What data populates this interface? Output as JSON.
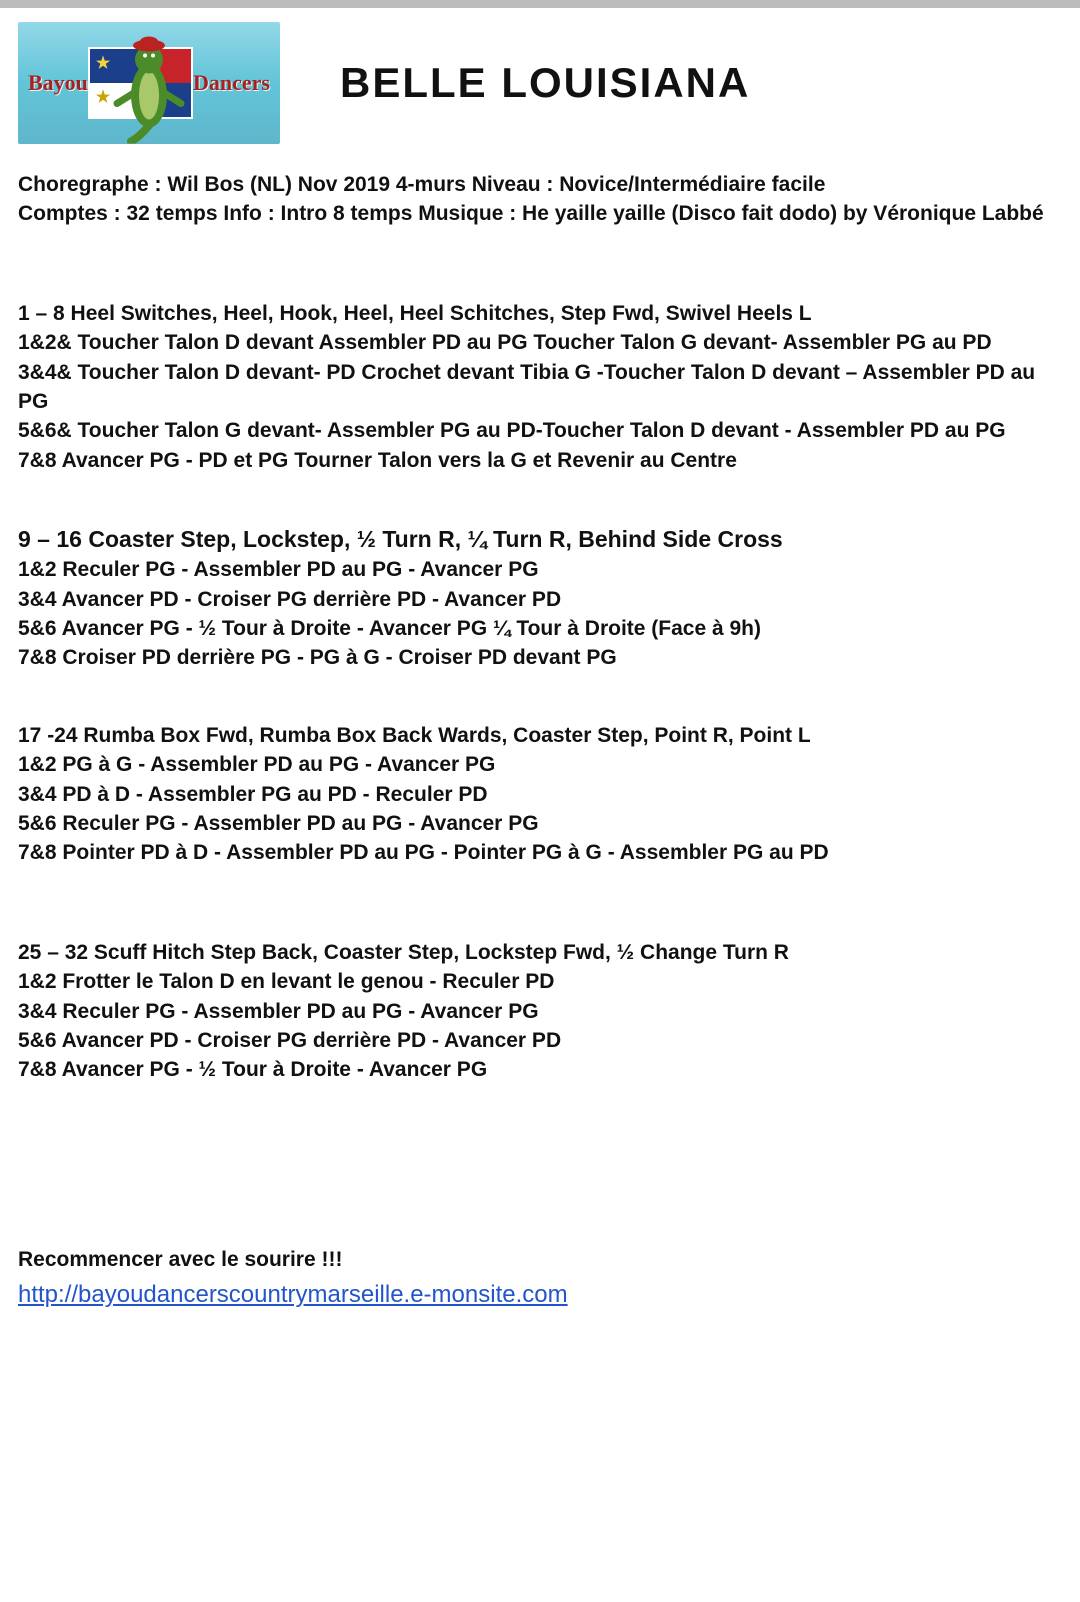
{
  "logo": {
    "left_text": "Bayou",
    "right_text": "Dancers"
  },
  "title": "BELLE LOUISIANA",
  "meta_lines": [
    "Choregraphe : Wil Bos (NL) Nov 2019 4-murs Niveau : Novice/Intermédiaire facile",
    "Comptes : 32 temps Info : Intro 8 temps Musique : He yaille yaille (Disco fait dodo) by Véronique Labbé"
  ],
  "sections": [
    {
      "head": "1 – 8 Heel Switches, Heel, Hook, Heel, Heel Schitches, Step Fwd, Swivel Heels L",
      "steps": [
        "1&2& Toucher Talon D devant Assembler PD au PG Toucher Talon G devant- Assembler PG au PD",
        "3&4& Toucher Talon D devant- PD Crochet devant Tibia G -Toucher Talon D devant – Assembler PD au PG",
        "5&6& Toucher Talon G devant- Assembler PG au PD-Toucher Talon D devant - Assembler PD au PG",
        "7&8 Avancer PG - PD et PG Tourner Talon vers la G et Revenir au Centre"
      ]
    },
    {
      "head": "9 – 16 Coaster Step, Lockstep, ½ Turn R, ¼ Turn R, Behind Side Cross",
      "head_big": true,
      "steps": [
        "1&2 Reculer PG - Assembler PD au PG - Avancer PG",
        "3&4 Avancer PD - Croiser PG derrière PD - Avancer PD",
        "5&6 Avancer PG - ½ Tour à Droite - Avancer PG ¼ Tour à Droite (Face à 9h)",
        "7&8 Croiser PD derrière PG - PG à G - Croiser PD devant PG"
      ]
    },
    {
      "head": "17 -24 Rumba Box Fwd, Rumba Box Back Wards, Coaster Step, Point R, Point L",
      "steps": [
        "1&2 PG à G - Assembler PD au PG - Avancer PG",
        "3&4 PD à D - Assembler PG au PD - Reculer PD",
        "5&6 Reculer PG - Assembler PD au PG - Avancer PG",
        "7&8 Pointer PD à D - Assembler PD au PG - Pointer PG à G - Assembler PG au PD"
      ]
    },
    {
      "head": "25 – 32 Scuff Hitch Step Back, Coaster Step, Lockstep Fwd, ½ Change Turn R",
      "steps": [
        "1&2 Frotter le Talon D en levant le genou - Reculer PD",
        "3&4 Reculer PG - Assembler PD au PG - Avancer PG",
        "5&6 Avancer PD - Croiser PG derrière PD - Avancer PD",
        "7&8 Avancer PG - ½ Tour à Droite - Avancer PG"
      ]
    }
  ],
  "footer_note": "Recommencer avec le sourire !!!",
  "site_url": "http://bayoudancerscountrymarseille.e-monsite.com"
}
